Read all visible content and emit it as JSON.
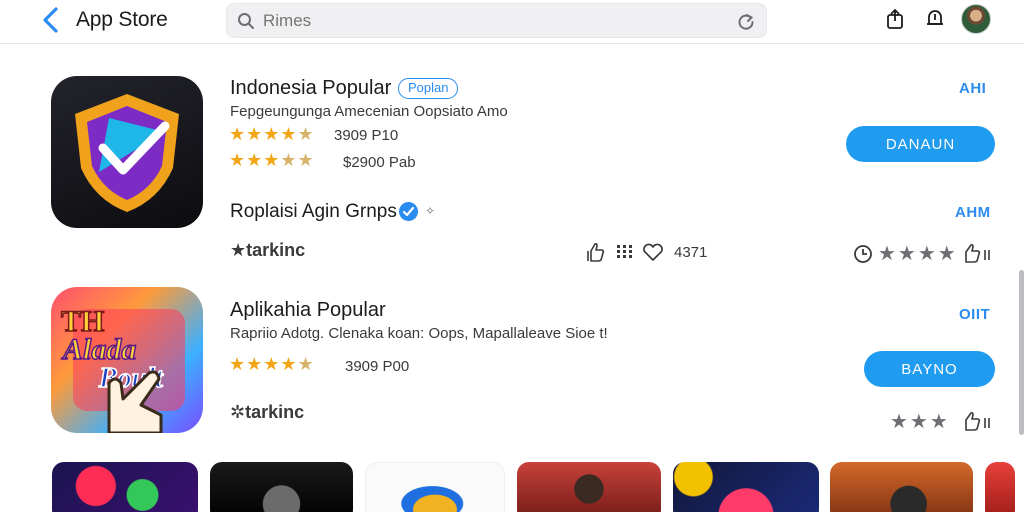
{
  "header": {
    "back_label": "App Store",
    "search_placeholder": "Rimes"
  },
  "apps": [
    {
      "name": "Indonesia Popular",
      "badge": "Poplan",
      "subtitle": "Fepgeungunga Amecenian Oopsiato Amo",
      "rating_lines": [
        {
          "stars": 4.5,
          "text": "3909 P10"
        },
        {
          "stars": 3.5,
          "text": "$2900 Pab"
        }
      ],
      "side_link": "AHI",
      "action_button": "DANAUN"
    },
    {
      "name": "Aplikahia Popular",
      "subtitle": "Rapriio Adotg. Clenaka koan: Oops, Mapallaleave Sioe t!",
      "rating_lines": [
        {
          "stars": 4.5,
          "text": "3909 P00"
        }
      ],
      "side_link": "OIIT",
      "action_button": "BAYNO"
    }
  ],
  "section": {
    "title": "Roplaisi Agin Grnps",
    "link": "AHM",
    "ranking_1": "tarkinc",
    "meta_count": "4371",
    "ranking_2": "tarkinc"
  },
  "colors": {
    "accent": "#2a8cf0",
    "button": "#1f9bf0",
    "star": "#f2a618"
  },
  "icons": [
    "chevron-left-icon",
    "search-icon",
    "refresh-icon",
    "share-icon",
    "bell-icon",
    "avatar",
    "verified-icon",
    "like-icon",
    "grid-icon",
    "heart-icon",
    "clock-icon",
    "thumbs-up-icon",
    "star-icon"
  ]
}
